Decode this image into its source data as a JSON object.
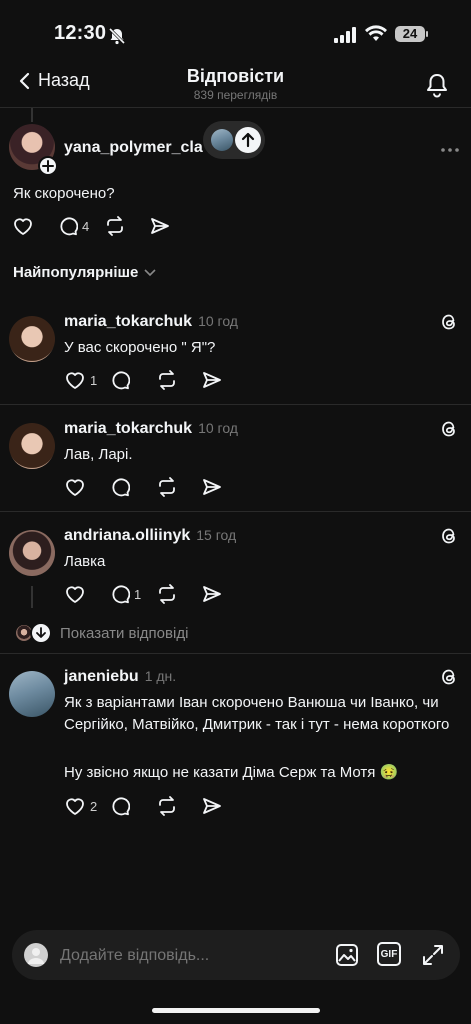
{
  "status_bar": {
    "time": "12:30",
    "battery": "24"
  },
  "nav": {
    "back_label": "Назад",
    "title": "Відповісти",
    "views": "839 переглядів"
  },
  "original_post": {
    "username": "yana_polymer_cla",
    "text": "Як скорочено?",
    "reply_count": "4"
  },
  "sort_label": "Найпопулярніше",
  "comments": [
    {
      "username": "maria_tokarchuk",
      "time": "10 год",
      "text": "У вас скорочено \" Я\"?",
      "like_count": "1",
      "reply_count": ""
    },
    {
      "username": "maria_tokarchuk",
      "time": "10 год",
      "text": "Лав, Ларі.",
      "like_count": "",
      "reply_count": ""
    },
    {
      "username": "andriana.olliinyk",
      "time": "15 год",
      "text": "Лавка",
      "like_count": "",
      "reply_count": "1"
    },
    {
      "username": "janeniebu",
      "time": "1 дн.",
      "text": "Як з варіантами Іван скорочено Ванюша чи Іванко, чи Сергійко, Матвійко, Дмитрик - так і тут - нема короткого",
      "text2": "Ну звісно якщо не казати Діма Серж та Мотя 🤢",
      "like_count": "2",
      "reply_count": ""
    }
  ],
  "show_replies_label": "Показати відповіді",
  "reply_bar": {
    "placeholder": "Додайте відповідь...",
    "gif_label": "GIF"
  },
  "colors": {
    "background": "#101010",
    "text": "#f3f5f7",
    "muted": "#777777",
    "divider": "#2a2a2a"
  }
}
